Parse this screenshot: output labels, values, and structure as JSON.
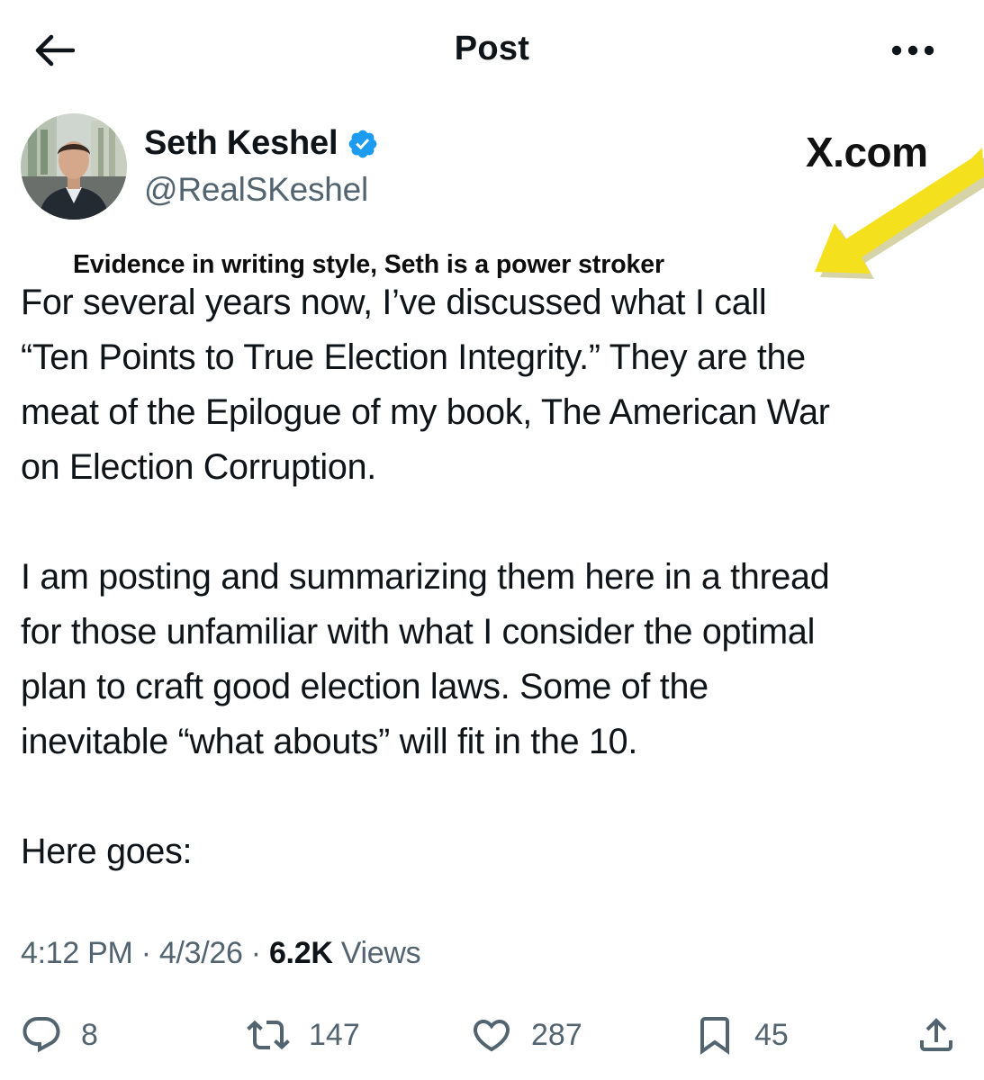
{
  "header": {
    "title": "Post",
    "back_icon": "arrow-left-icon",
    "more_icon": "more-horizontal-icon"
  },
  "author": {
    "name": "Seth Keshel",
    "handle": "@RealSKeshel",
    "verified_icon": "verified-badge-icon",
    "verified_color": "#1d9bf0"
  },
  "overlay": {
    "watermark": "X.com",
    "annotation": "Evidence in writing style, Seth is a power stroker",
    "arrow_color": "#f4e01d"
  },
  "tweet": {
    "paragraphs": [
      "For several years now, I’ve discussed what I call\n“Ten Points to True Election Integrity.” They are the\nmeat of the Epilogue of my book, The American War\non Election Corruption.",
      "I am posting and summarizing them here in a thread\nfor those unfamiliar with what I consider the optimal\nplan to craft good election laws. Some of the\ninevitable “what abouts” will fit in the 10.",
      "Here goes:"
    ]
  },
  "meta": {
    "time": "4:12 PM",
    "separator": "·",
    "date": "4/3/26",
    "views_count": "6.2K",
    "views_label": "Views"
  },
  "actions": {
    "replies": "8",
    "reposts": "147",
    "likes": "287",
    "bookmarks": "45"
  }
}
